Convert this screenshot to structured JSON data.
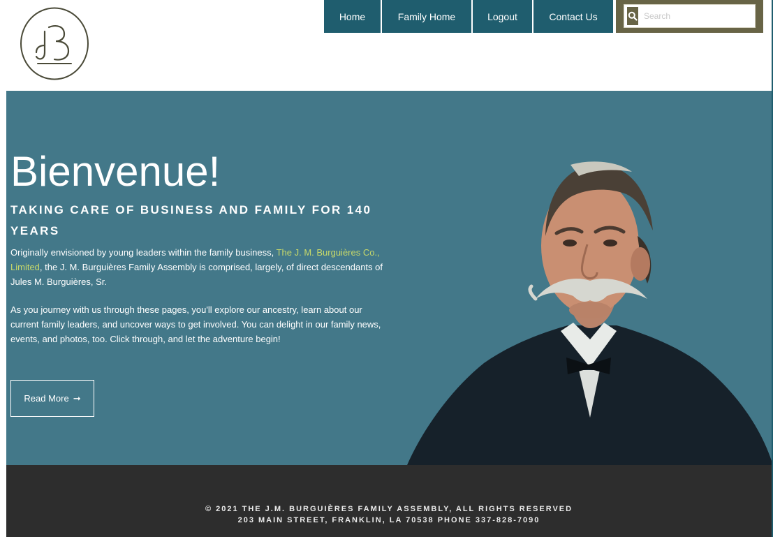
{
  "nav": {
    "items": [
      {
        "label": "Home"
      },
      {
        "label": "Family Home"
      },
      {
        "label": "Logout"
      },
      {
        "label": "Contact Us"
      }
    ]
  },
  "search": {
    "placeholder": "Search"
  },
  "hero": {
    "title": "Bienvenue!",
    "subtitle": "TAKING CARE OF BUSINESS AND FAMILY FOR 140 YEARS",
    "p1_before": "Originally envisioned by young leaders within the family business, ",
    "p1_link": "The J. M. Burguières Co., Limited",
    "p1_after": ", the J. M. Burguières Family Assembly is comprised, largely, of direct descendants of Jules M. Burguières, Sr.",
    "p2": "As you journey with us through these pages, you'll explore our ancestry, learn about our current family leaders, and uncover ways to get involved. You can delight in our family news, events, and photos, too. Click through, and let the adventure begin!",
    "read_more_label": "Read More",
    "read_more_arrow": "➞"
  },
  "footer": {
    "line1": "© 2021 THE J.M. BURGUIÈRES FAMILY ASSEMBLY, ALL RIGHTS RESERVED",
    "line2": "203 MAIN STREET, FRANKLIN, LA 70538 PHONE 337-828-7090"
  },
  "colors": {
    "nav_bg": "#1f5d6e",
    "search_frame": "#686446",
    "hero_bg": "#437889",
    "link": "#c8d96a",
    "footer_bg": "#2d2d2d"
  },
  "icons": {
    "logo": "jb-monogram-logo",
    "search": "search-icon",
    "arrow": "arrow-right-icon"
  }
}
